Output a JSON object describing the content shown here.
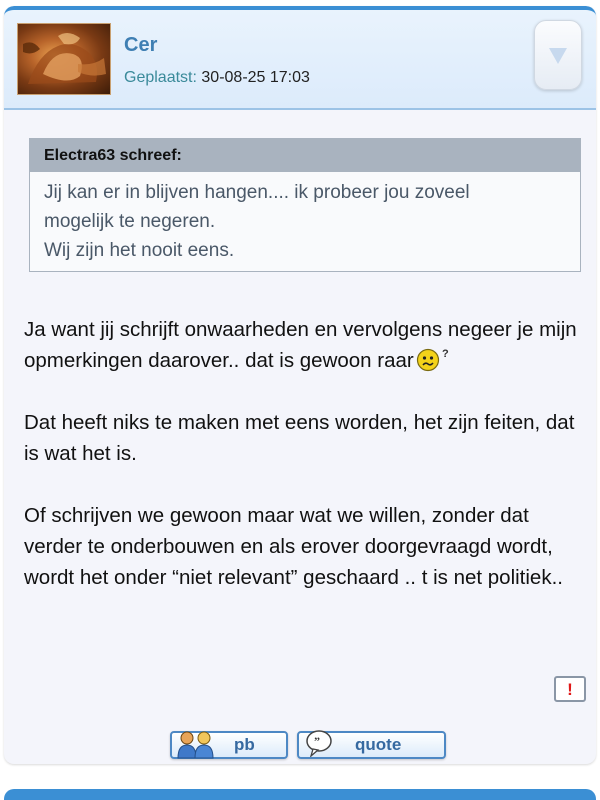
{
  "post": {
    "author": "Cer",
    "posted_label": "Geplaatst:",
    "posted_value": "30-08-25 17:03",
    "avatar_icon": "avatar-image",
    "collapse_icon": "chevron-down-icon"
  },
  "quote": {
    "header": "Electra63 schreef:",
    "lines": [
      "Jij kan er in blijven hangen.... ik probeer jou zoveel",
      "mogelijk te negeren.",
      "Wij zijn het nooit eens."
    ]
  },
  "body": {
    "p1_text": "Ja want jij schrijft onwaarheden en vervolgens negeer je mijn opmerkingen daarover.. dat is gewoon raar",
    "p1_smiley": "confused-smiley-icon",
    "p1_smiley_mark": "?",
    "p2": "Dat heeft niks te maken met eens worden, het zijn feiten, dat is wat het is.",
    "p3": "Of schrijven we gewoon maar wat we willen, zonder dat verder te onderbouwen en als erover doorgevraagd wordt, wordt het onder “niet relevant” geschaard .. t is net politiek.."
  },
  "actions": {
    "report_mark": "!",
    "pm_label": "pb",
    "quote_label": "quote"
  },
  "colors": {
    "accent": "#3b8fd4",
    "username": "#3f7fb3",
    "quote_header_bg": "#a9b3bf",
    "report": "#e01818"
  }
}
